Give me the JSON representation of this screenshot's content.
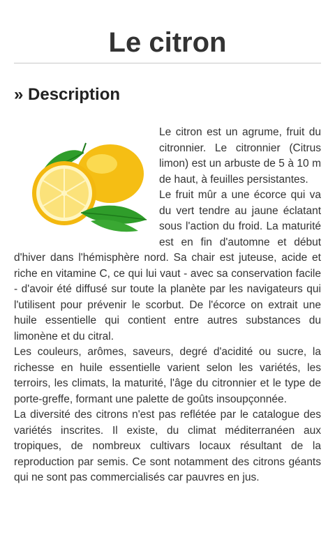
{
  "page": {
    "title": "Le citron"
  },
  "description": {
    "heading": "» Description",
    "image": {
      "subject": "lemon-image",
      "colors": {
        "lemon": "#f7c61c",
        "lemon_light": "#fde66a",
        "flesh": "#fbe27a",
        "leaf": "#2f9d2a",
        "leaf_dark": "#1c7a1a"
      }
    },
    "paragraphs": [
      "Le citron est un agrume, fruit du citronnier. Le citronnier (Citrus limon) est un arbuste de 5 à 10 m de haut, à feuilles persistantes.",
      "Le fruit mûr a une écorce qui va du vert tendre au jaune éclatant sous l'action du froid. La maturité est en fin d'automne et début d'hiver dans l'hémisphère nord. Sa chair est juteuse, acide et riche en vitamine C, ce qui lui vaut - avec sa conservation facile - d'avoir été diffusé sur toute la planète par les navigateurs qui l'utilisent pour prévenir le scorbut. De l'écorce on extrait une huile essentielle qui contient entre autres substances du limonène et du citral.",
      "Les couleurs, arômes, saveurs, degré d'acidité ou sucre, la richesse en huile essentielle varient selon les variétés, les terroirs, les climats, la maturité, l'âge du citronnier et le type de porte-greffe, formant une palette de goûts insoupçonnée.",
      "La diversité des citrons n'est pas reflétée par le catalogue des variétés inscrites. Il existe, du climat méditerranéen aux tropiques, de nombreux cultivars locaux résultant de la reproduction par semis. Ce sont notamment des citrons géants qui ne sont pas commercialisés car pauvres en jus."
    ]
  }
}
